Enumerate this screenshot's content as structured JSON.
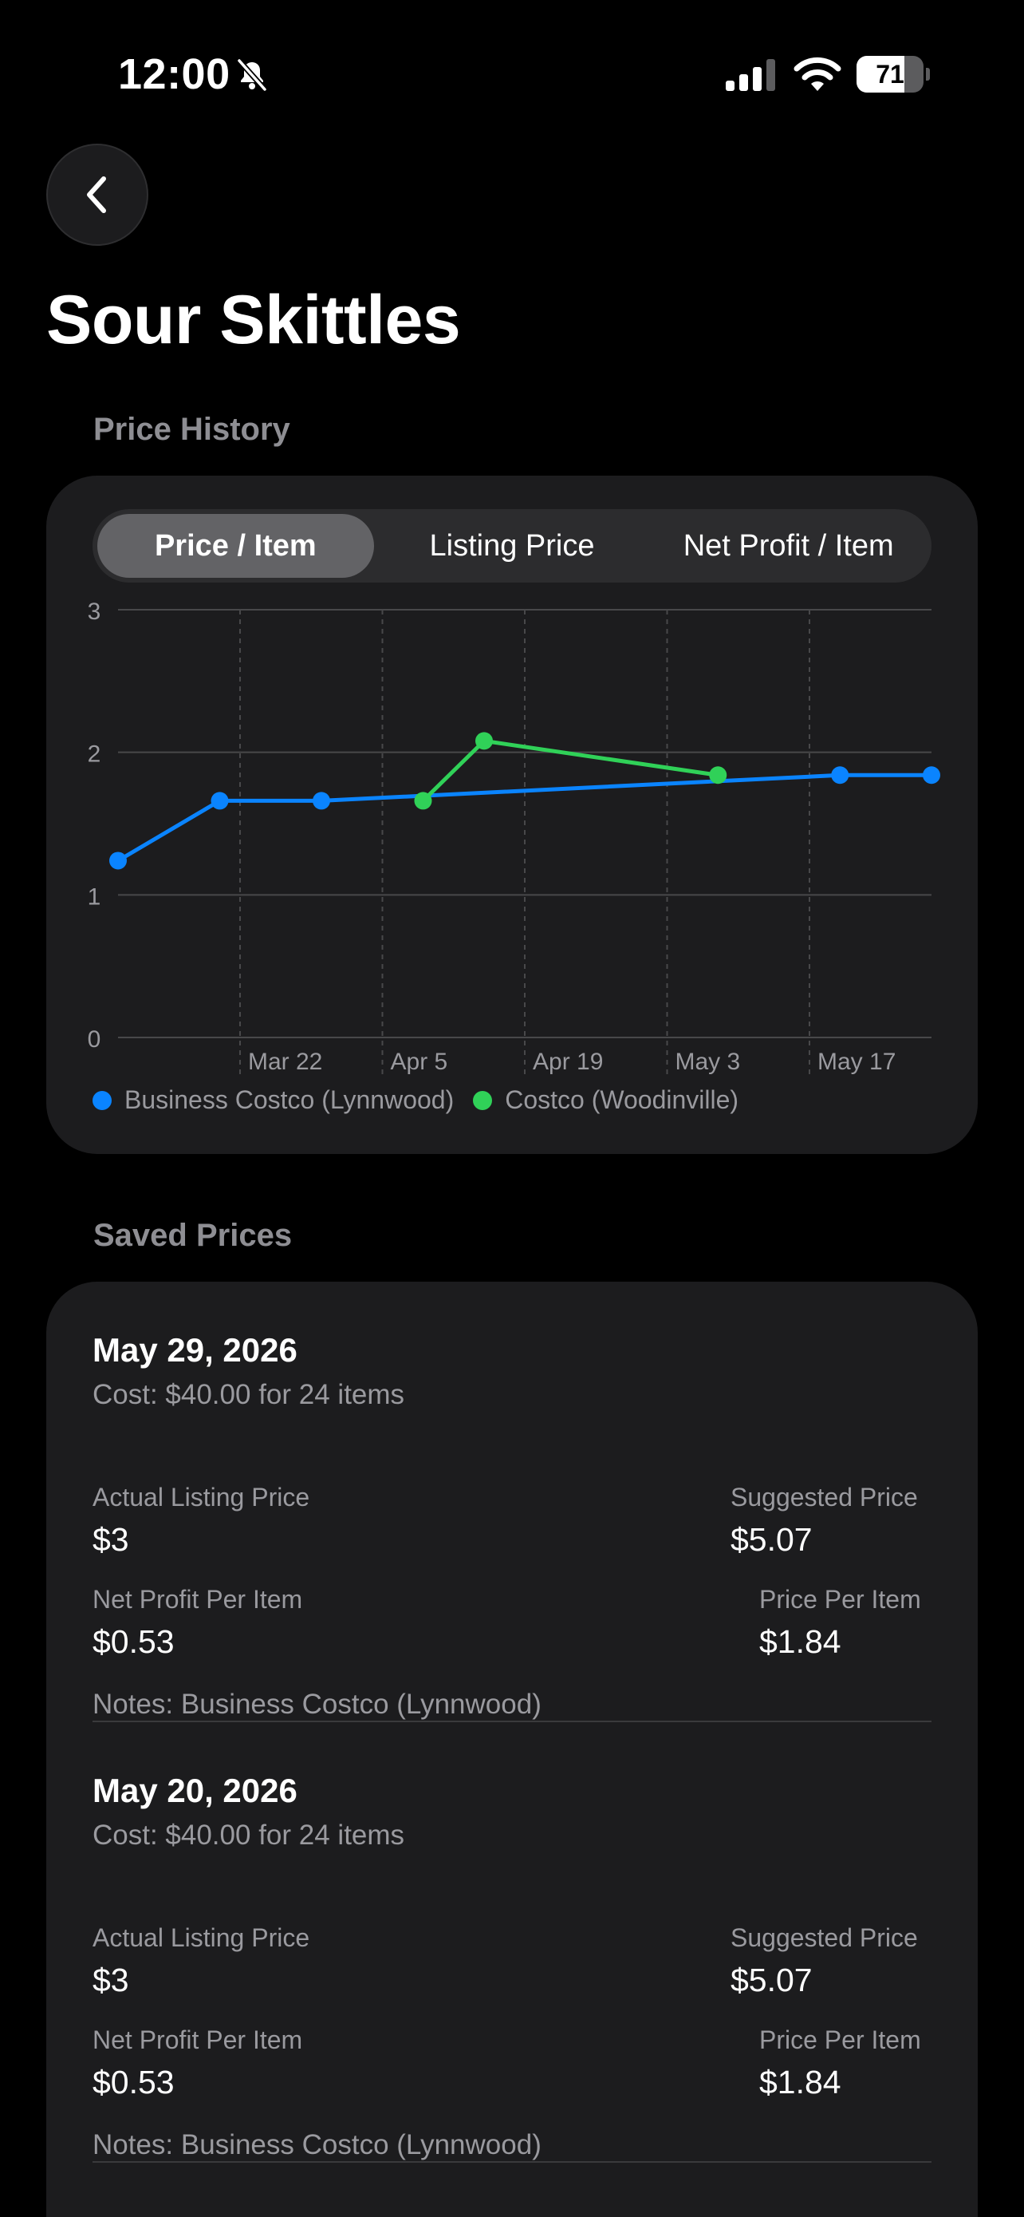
{
  "status_bar": {
    "time": "12:00",
    "battery": "71",
    "battery_level": 0.71
  },
  "page": {
    "title": "Sour Skittles"
  },
  "price_history": {
    "section_label": "Price History",
    "tabs": [
      "Price / Item",
      "Listing Price",
      "Net Profit / Item"
    ],
    "active_tab": 0
  },
  "chart_data": {
    "type": "line",
    "x_tick_labels": [
      "Mar 22",
      "Apr 5",
      "Apr 19",
      "May 3",
      "May 17"
    ],
    "x_ticks": [
      "2026-03-22",
      "2026-04-05",
      "2026-04-19",
      "2026-05-03",
      "2026-05-17"
    ],
    "x_range": [
      "2026-03-10",
      "2026-05-29"
    ],
    "ylim": [
      0,
      3
    ],
    "y_ticks": [
      0,
      1,
      2,
      3
    ],
    "grid": true,
    "legend_position": "bottom",
    "series": [
      {
        "name": "Business Costco (Lynnwood)",
        "color": "#0a84ff",
        "points": [
          {
            "x": "2026-03-10",
            "y": 1.24
          },
          {
            "x": "2026-03-20",
            "y": 1.66
          },
          {
            "x": "2026-03-30",
            "y": 1.66
          },
          {
            "x": "2026-05-20",
            "y": 1.84
          },
          {
            "x": "2026-05-29",
            "y": 1.84
          }
        ]
      },
      {
        "name": "Costco (Woodinville)",
        "color": "#30d158",
        "points": [
          {
            "x": "2026-04-09",
            "y": 1.66
          },
          {
            "x": "2026-04-15",
            "y": 2.08
          },
          {
            "x": "2026-05-08",
            "y": 1.84
          }
        ]
      }
    ]
  },
  "saved_prices": {
    "section_label": "Saved Prices",
    "entries": [
      {
        "date": "May 29, 2026",
        "cost": "Cost: $40.00 for 24 items",
        "actual_listing_label": "Actual Listing Price",
        "actual_listing_value": "$3",
        "suggested_label": "Suggested Price",
        "suggested_value": "$5.07",
        "net_profit_label": "Net Profit Per Item",
        "net_profit_value": "$0.53",
        "price_per_item_label": "Price Per Item",
        "price_per_item_value": "$1.84",
        "notes": "Notes: Business Costco (Lynnwood)"
      },
      {
        "date": "May 20, 2026",
        "cost": "Cost: $40.00 for 24 items",
        "actual_listing_label": "Actual Listing Price",
        "actual_listing_value": "$3",
        "suggested_label": "Suggested Price",
        "suggested_value": "$5.07",
        "net_profit_label": "Net Profit Per Item",
        "net_profit_value": "$0.53",
        "price_per_item_label": "Price Per Item",
        "price_per_item_value": "$1.84",
        "notes": "Notes: Business Costco (Lynnwood)"
      }
    ]
  }
}
